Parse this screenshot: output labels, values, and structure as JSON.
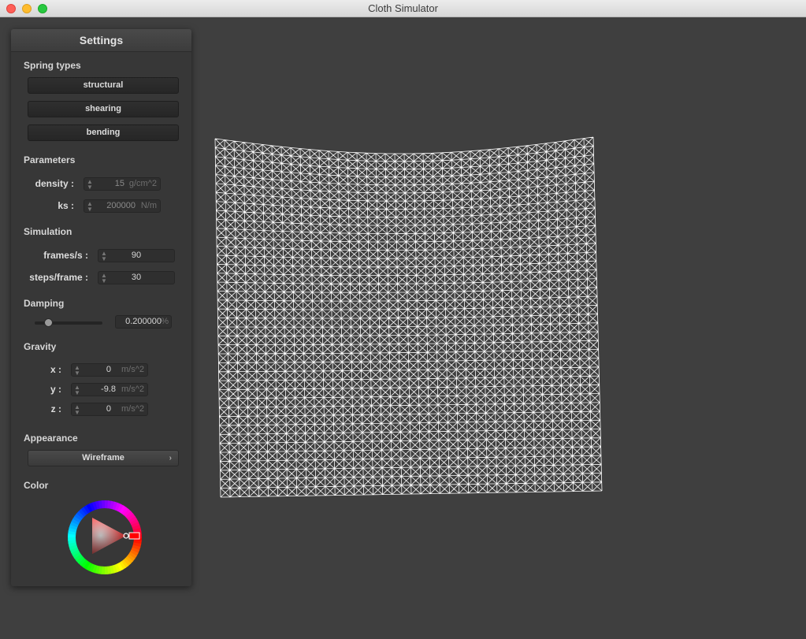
{
  "window": {
    "title": "Cloth Simulator"
  },
  "panel": {
    "title": "Settings",
    "spring_types": {
      "label": "Spring types",
      "buttons": [
        "structural",
        "shearing",
        "bending"
      ]
    },
    "parameters": {
      "label": "Parameters",
      "density": {
        "label": "density :",
        "value": "15",
        "unit": "g/cm^2"
      },
      "ks": {
        "label": "ks :",
        "value": "200000",
        "unit": "N/m"
      }
    },
    "simulation": {
      "label": "Simulation",
      "fps": {
        "label": "frames/s :",
        "value": "90"
      },
      "steps": {
        "label": "steps/frame :",
        "value": "30"
      }
    },
    "damping": {
      "label": "Damping",
      "fraction": 0.2,
      "value": "0.200000",
      "unit": "%"
    },
    "gravity": {
      "label": "Gravity",
      "x": {
        "label": "x :",
        "value": "0",
        "unit": "m/s^2"
      },
      "y": {
        "label": "y :",
        "value": "-9.8",
        "unit": "m/s^2"
      },
      "z": {
        "label": "z :",
        "value": "0",
        "unit": "m/s^2"
      }
    },
    "appearance": {
      "label": "Appearance",
      "selected": "Wireframe"
    },
    "color": {
      "label": "Color",
      "selected": "#ff0000"
    }
  },
  "cloth": {
    "render_mode": "wireframe",
    "line_color": "#ffffff",
    "background": "#3f3f3f"
  }
}
